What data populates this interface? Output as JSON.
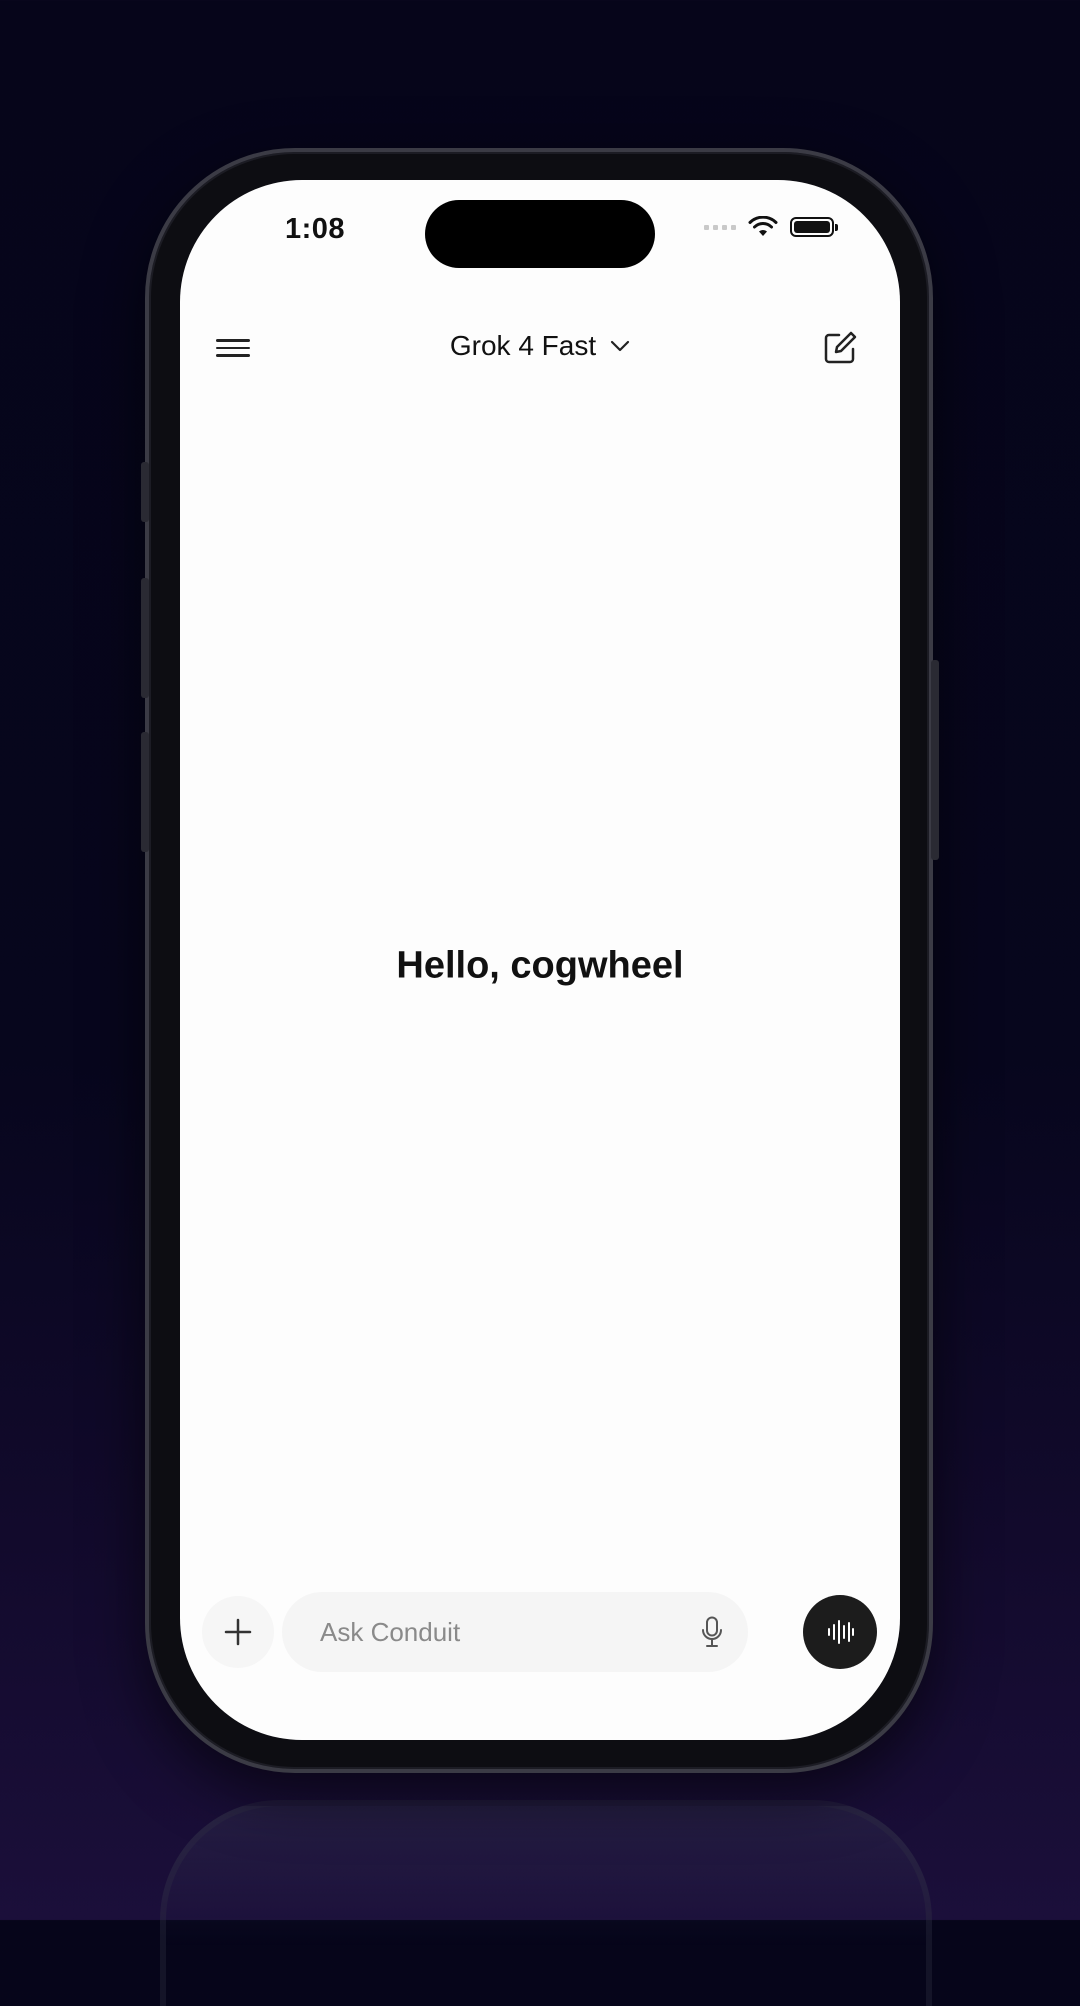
{
  "status_bar": {
    "time": "1:08"
  },
  "header": {
    "menu_icon": "hamburger-menu-icon",
    "model_name": "Grok 4 Fast",
    "model_dropdown_icon": "chevron-down-icon",
    "new_chat_icon": "compose-icon"
  },
  "main": {
    "greeting": "Hello, cogwheel"
  },
  "composer": {
    "attach_icon": "plus-icon",
    "placeholder": "Ask Conduit",
    "mic_icon": "microphone-icon",
    "voice_icon": "voice-waveform-icon"
  },
  "colors": {
    "background": "#06051a",
    "screen": "#fdfdfd",
    "text": "#111111",
    "voice_button": "#1c1c1c"
  }
}
